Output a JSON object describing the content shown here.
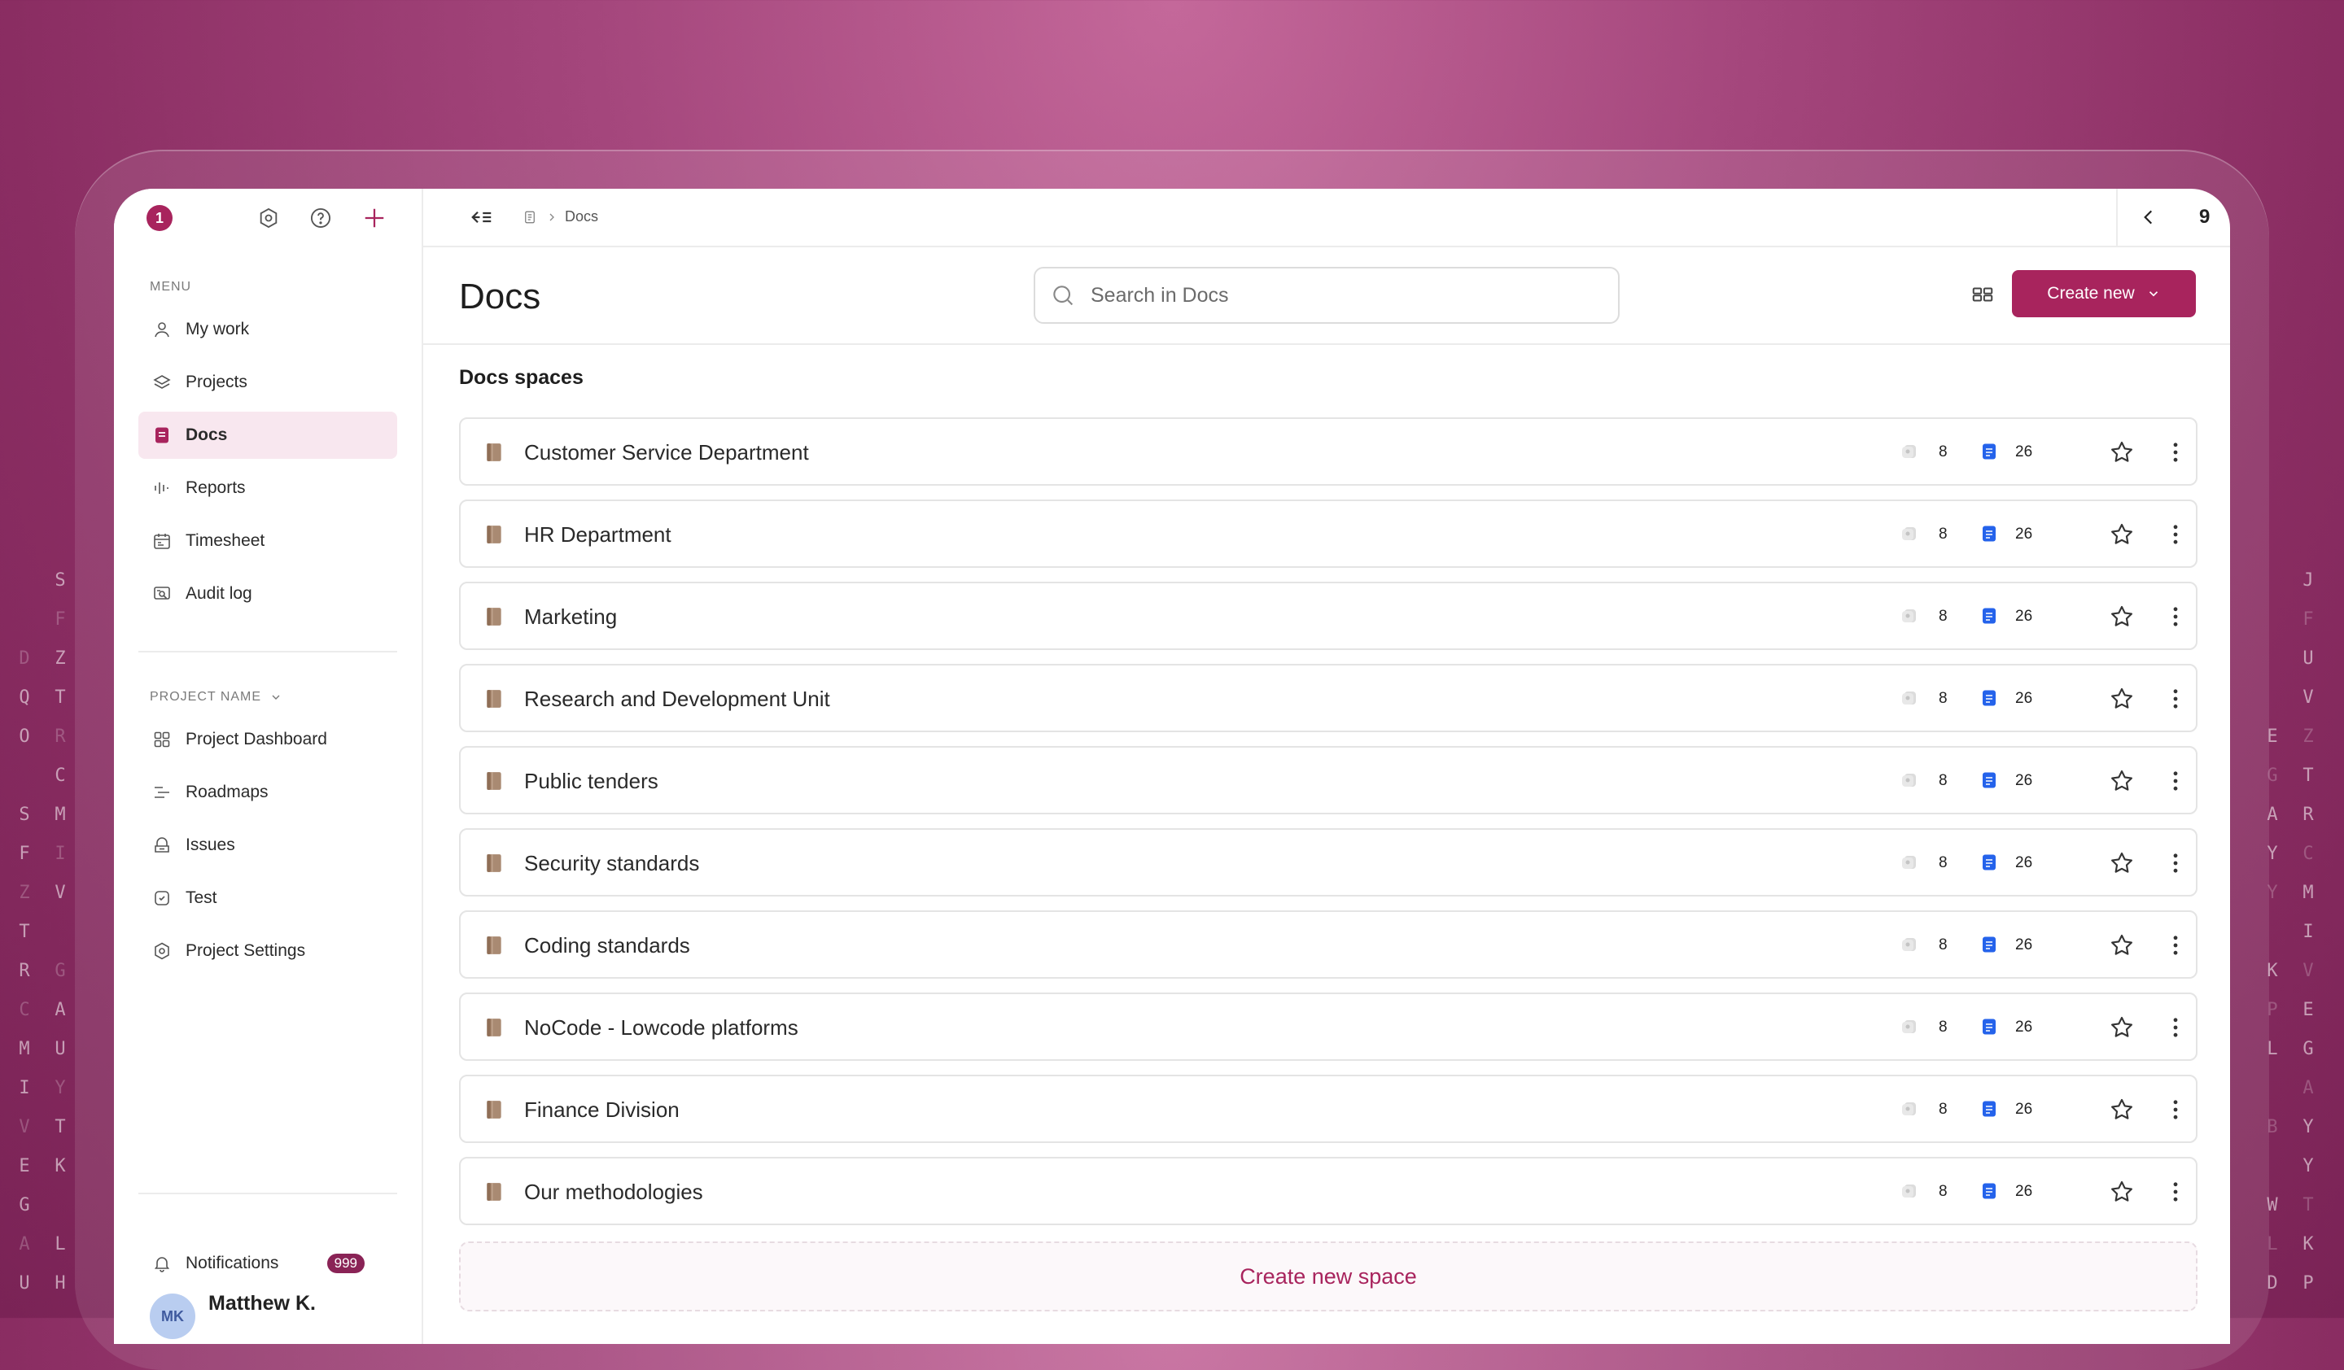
{
  "app": {
    "logo_glyph": "1",
    "accent_color": "#a8245d"
  },
  "sidebar": {
    "menu_label": "MENU",
    "menu_items": [
      {
        "label": "My work",
        "icon": "user-icon"
      },
      {
        "label": "Projects",
        "icon": "layers-icon"
      },
      {
        "label": "Docs",
        "icon": "doc-icon",
        "active": true
      },
      {
        "label": "Reports",
        "icon": "bar-chart-icon"
      },
      {
        "label": "Timesheet",
        "icon": "calendar-icon"
      },
      {
        "label": "Audit log",
        "icon": "audit-icon"
      }
    ],
    "project_label": "PROJECT NAME",
    "project_items": [
      {
        "label": "Project Dashboard",
        "icon": "grid-icon"
      },
      {
        "label": "Roadmaps",
        "icon": "roadmap-icon"
      },
      {
        "label": "Issues",
        "icon": "issues-icon"
      },
      {
        "label": "Test",
        "icon": "test-icon"
      },
      {
        "label": "Project Settings",
        "icon": "settings-icon"
      }
    ],
    "notifications": {
      "label": "Notifications",
      "count": "999"
    },
    "user": {
      "initials": "MK",
      "name": "Matthew K."
    }
  },
  "topbar": {
    "breadcrumb": [
      "Docs"
    ],
    "page_counter": "9"
  },
  "header": {
    "title": "Docs",
    "search_placeholder": "Search in Docs",
    "create_label": "Create new"
  },
  "spaces": {
    "title": "Docs spaces",
    "items": [
      {
        "name": "Customer Service Department",
        "count_a": "8",
        "count_b": "26"
      },
      {
        "name": "HR Department",
        "count_a": "8",
        "count_b": "26"
      },
      {
        "name": "Marketing",
        "count_a": "8",
        "count_b": "26"
      },
      {
        "name": "Research and Development Unit",
        "count_a": "8",
        "count_b": "26"
      },
      {
        "name": "Public tenders",
        "count_a": "8",
        "count_b": "26"
      },
      {
        "name": "Security standards",
        "count_a": "8",
        "count_b": "26"
      },
      {
        "name": "Coding standards",
        "count_a": "8",
        "count_b": "26"
      },
      {
        "name": "NoCode - Lowcode platforms",
        "count_a": "8",
        "count_b": "26"
      },
      {
        "name": "Finance Division",
        "count_a": "8",
        "count_b": "26"
      },
      {
        "name": "Our methodologies",
        "count_a": "8",
        "count_b": "26"
      }
    ],
    "create_space_label": "Create new space"
  },
  "decor": {
    "left_letters": [
      [
        "",
        "S"
      ],
      [
        "",
        "F"
      ],
      [
        "D",
        "Z"
      ],
      [
        "Q",
        "T"
      ],
      [
        "O",
        "R"
      ],
      [
        "",
        "C"
      ],
      [
        "S",
        "M"
      ],
      [
        "F",
        "I"
      ],
      [
        "Z",
        "V"
      ],
      [
        "T",
        ""
      ],
      [
        "R",
        "G"
      ],
      [
        "C",
        "A"
      ],
      [
        "M",
        "U"
      ],
      [
        "I",
        "Y"
      ],
      [
        "V",
        "T"
      ],
      [
        "E",
        "K"
      ],
      [
        "G",
        ""
      ],
      [
        "A",
        "L"
      ],
      [
        "U",
        "H"
      ]
    ],
    "right_letters": [
      [
        "",
        "J"
      ],
      [
        "",
        "F"
      ],
      [
        "",
        "U"
      ],
      [
        "",
        "V"
      ],
      [
        "E",
        "Z"
      ],
      [
        "G",
        "T"
      ],
      [
        "A",
        "R"
      ],
      [
        "Y",
        "C"
      ],
      [
        "Y",
        "M"
      ],
      [
        "",
        "I"
      ],
      [
        "K",
        "V"
      ],
      [
        "P",
        "E"
      ],
      [
        "L",
        "G"
      ],
      [
        "",
        "A"
      ],
      [
        "B",
        "Y"
      ],
      [
        "",
        "Y"
      ],
      [
        "W",
        "T"
      ],
      [
        "L",
        "K"
      ],
      [
        "D",
        "P"
      ]
    ]
  }
}
